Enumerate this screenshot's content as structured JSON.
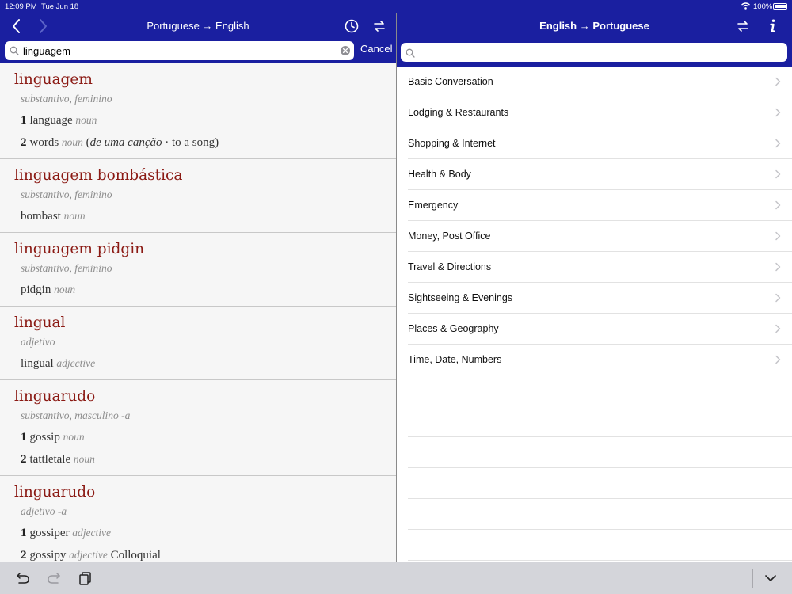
{
  "status": {
    "time": "12:09 PM",
    "date": "Tue Jun 18",
    "battery": "100%"
  },
  "left": {
    "title": "Portuguese → English",
    "search": {
      "value": "linguagem",
      "placeholder": ""
    },
    "cancel_label": "Cancel",
    "entries": [
      {
        "headword": "linguagem",
        "gram": "substantivo, feminino",
        "senses": [
          {
            "num": "1",
            "word": "language",
            "pos": "noun"
          },
          {
            "num": "2",
            "word": "words",
            "pos": "noun",
            "ctx_open": " (",
            "ctx": "de uma canção",
            "ctx_rest": " · to a song)"
          }
        ]
      },
      {
        "headword": "linguagem bombástica",
        "gram": "substantivo, feminino",
        "senses": [
          {
            "num": "",
            "word": "bombast",
            "pos": "noun"
          }
        ]
      },
      {
        "headword": "linguagem pidgin",
        "gram": "substantivo, feminino",
        "senses": [
          {
            "num": "",
            "word": "pidgin",
            "pos": "noun"
          }
        ]
      },
      {
        "headword": "lingual",
        "gram": "adjetivo",
        "senses": [
          {
            "num": "",
            "word": "lingual",
            "pos": "adjective"
          }
        ]
      },
      {
        "headword": "linguarudo",
        "gram": "substantivo, masculino -a",
        "senses": [
          {
            "num": "1",
            "word": "gossip",
            "pos": "noun"
          },
          {
            "num": "2",
            "word": "tattletale",
            "pos": "noun"
          }
        ]
      },
      {
        "headword": "linguarudo",
        "gram": "adjetivo -a",
        "senses": [
          {
            "num": "1",
            "word": "gossiper",
            "pos": "adjective"
          },
          {
            "num": "2",
            "word": "gossipy",
            "pos": "adjective",
            "extra": "Colloquial"
          }
        ]
      }
    ]
  },
  "right": {
    "title": "English → Portuguese",
    "search": {
      "value": "",
      "placeholder": ""
    },
    "categories": [
      "Basic Conversation",
      "Lodging & Restaurants",
      "Shopping & Internet",
      "Health & Body",
      "Emergency",
      "Money, Post Office",
      "Travel & Directions",
      "Sightseeing & Evenings",
      "Places & Geography",
      "Time, Date, Numbers"
    ],
    "empty_rows": 7
  },
  "colors": {
    "nav_bg": "#1a1fa0",
    "headword": "#8b1a14",
    "toolbar_bg": "#d4d5da"
  },
  "icons": {
    "left_nav": [
      "back-arrow-icon",
      "forward-arrow-icon",
      "history-clock-icon",
      "swap-direction-icon"
    ],
    "right_nav": [
      "swap-direction-icon",
      "info-icon"
    ],
    "toolbar": [
      "undo-icon",
      "redo-icon",
      "paste-icon",
      "keyboard-dismiss-icon"
    ]
  }
}
